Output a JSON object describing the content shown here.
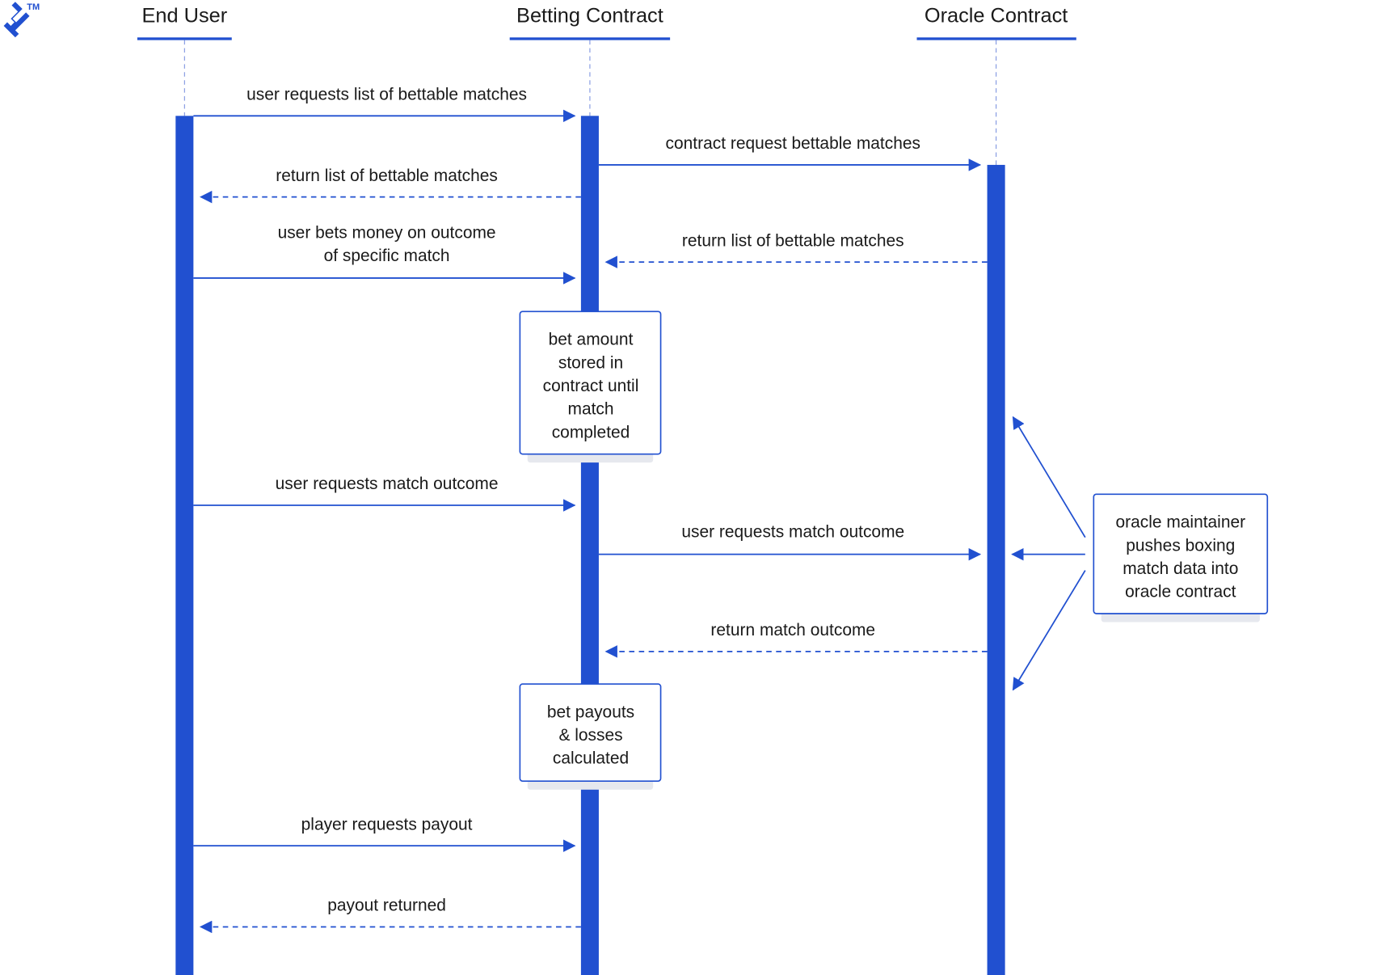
{
  "logo": {
    "icon": "toptal-logo-icon",
    "trademark": "TM"
  },
  "colors": {
    "accent": "#2150d0",
    "text": "#1a1a1a",
    "shadow": "#e6e8ee",
    "lifeline": "#7f95e0"
  },
  "participants": [
    {
      "id": "end_user",
      "label": "End User"
    },
    {
      "id": "betting",
      "label": "Betting Contract"
    },
    {
      "id": "oracle",
      "label": "Oracle Contract"
    }
  ],
  "messages": [
    {
      "from": "end_user",
      "to": "betting",
      "style": "solid",
      "lines": [
        "user requests list of bettable matches"
      ]
    },
    {
      "from": "betting",
      "to": "oracle",
      "style": "solid",
      "lines": [
        "contract request bettable matches"
      ]
    },
    {
      "from": "betting",
      "to": "end_user",
      "style": "dashed",
      "lines": [
        "return list of bettable matches"
      ]
    },
    {
      "from": "end_user",
      "to": "betting",
      "style": "solid",
      "lines": [
        "user bets money on outcome",
        "of specific match"
      ]
    },
    {
      "from": "oracle",
      "to": "betting",
      "style": "dashed",
      "lines": [
        "return list of bettable matches"
      ]
    },
    {
      "from": "end_user",
      "to": "betting",
      "style": "solid",
      "lines": [
        "user requests match outcome"
      ]
    },
    {
      "from": "betting",
      "to": "oracle",
      "style": "solid",
      "lines": [
        "user requests match outcome"
      ]
    },
    {
      "from": "oracle",
      "to": "betting",
      "style": "dashed",
      "lines": [
        "return match outcome"
      ]
    },
    {
      "from": "end_user",
      "to": "betting",
      "style": "solid",
      "lines": [
        "player requests payout"
      ]
    },
    {
      "from": "betting",
      "to": "end_user",
      "style": "dashed",
      "lines": [
        "payout returned"
      ]
    }
  ],
  "notes": [
    {
      "on": "betting",
      "lines": [
        "bet amount",
        "stored in",
        "contract until",
        "match",
        "completed"
      ]
    },
    {
      "on": "betting",
      "lines": [
        "bet payouts",
        "& losses",
        "calculated"
      ]
    },
    {
      "on": "external",
      "lines": [
        "oracle maintainer",
        "pushes boxing",
        "match data into",
        "oracle contract"
      ]
    }
  ]
}
